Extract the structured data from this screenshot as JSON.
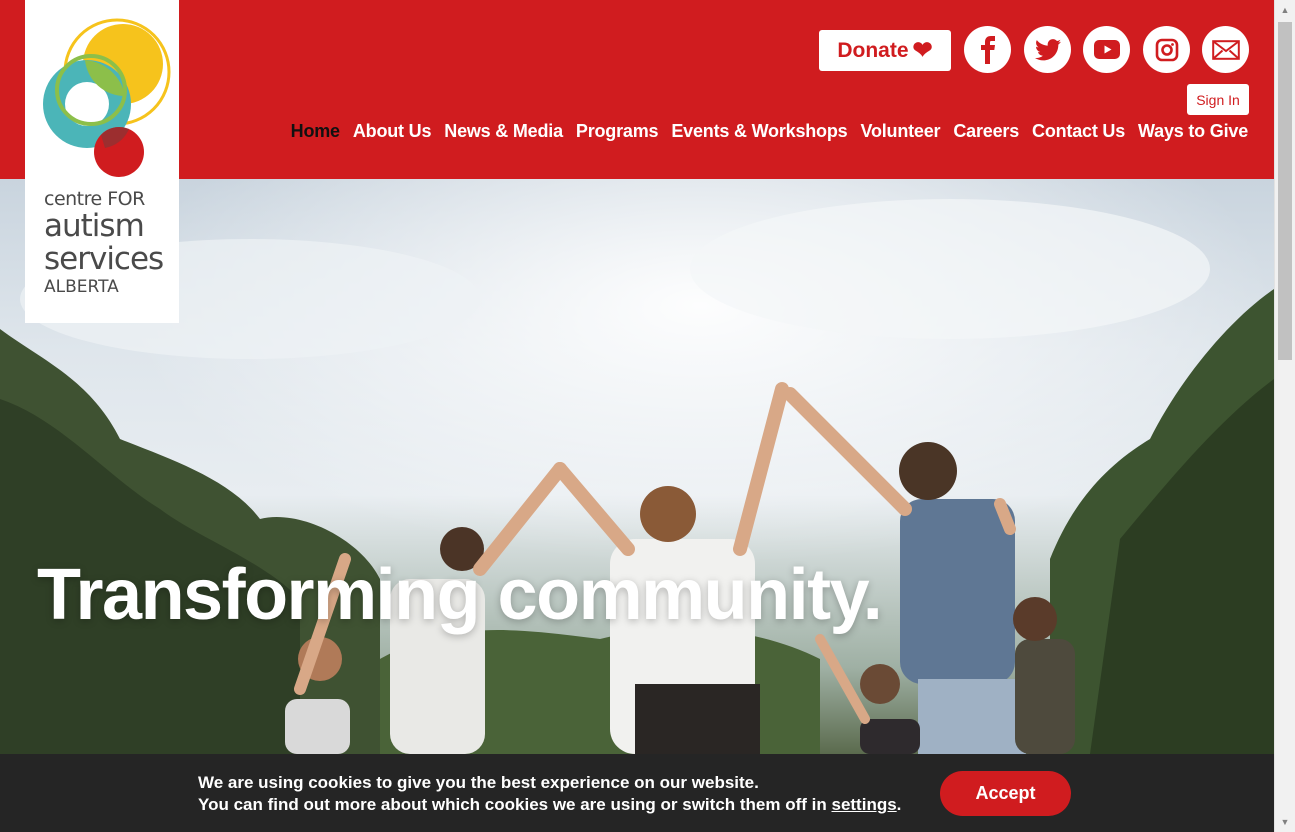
{
  "logo": {
    "line1": "centre FOR",
    "line2": "autism",
    "line3": "services",
    "line4": "ALBERTA"
  },
  "header": {
    "donate_label": "Donate",
    "donate_icon": "heart-icon",
    "signin_label": "Sign In",
    "social": [
      {
        "name": "facebook-icon"
      },
      {
        "name": "twitter-icon"
      },
      {
        "name": "youtube-icon"
      },
      {
        "name": "instagram-icon"
      },
      {
        "name": "email-icon"
      }
    ]
  },
  "nav": {
    "items": [
      {
        "label": "Home",
        "active": true
      },
      {
        "label": "About Us"
      },
      {
        "label": "News & Media"
      },
      {
        "label": "Programs"
      },
      {
        "label": "Events & Workshops"
      },
      {
        "label": "Volunteer"
      },
      {
        "label": "Careers"
      },
      {
        "label": "Contact Us"
      },
      {
        "label": "Ways to Give"
      }
    ]
  },
  "hero": {
    "headline": "Transforming community."
  },
  "cookie": {
    "line1": "We are using cookies to give you the best experience on our website.",
    "line2_prefix": "You can find out more about which cookies we are using or switch them off in ",
    "settings_link": "settings",
    "line2_suffix": ".",
    "accept_label": "Accept"
  },
  "colors": {
    "brand_red": "#d01c1f",
    "cookie_bg": "#252525",
    "logo_yellow": "#f6c31c",
    "logo_teal": "#4bb5b8",
    "logo_green": "#8cbf4a"
  }
}
